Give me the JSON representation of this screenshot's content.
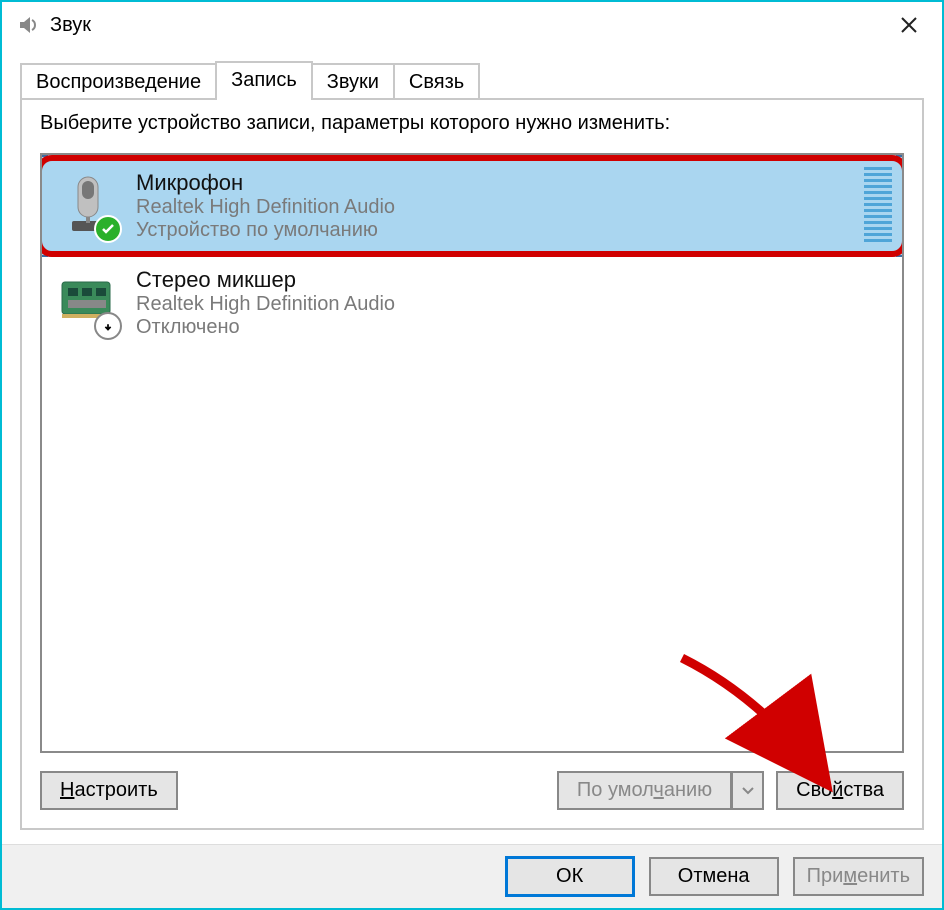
{
  "window": {
    "title": "Звук"
  },
  "tabs": {
    "items": [
      {
        "label": "Воспроизведение"
      },
      {
        "label": "Запись"
      },
      {
        "label": "Звуки"
      },
      {
        "label": "Связь"
      }
    ],
    "activeIndex": 1
  },
  "instruction": "Выберите устройство записи, параметры которого нужно изменить:",
  "devices": [
    {
      "name": "Микрофон",
      "driver": "Realtek High Definition Audio",
      "status": "Устройство по умолчанию",
      "selected": true,
      "badge": "default"
    },
    {
      "name": "Стерео микшер",
      "driver": "Realtek High Definition Audio",
      "status": "Отключено",
      "selected": false,
      "badge": "disabled"
    }
  ],
  "panelButtons": {
    "configure": "Настроить",
    "default": "По умолчанию",
    "properties": "Свойства"
  },
  "dialogButtons": {
    "ok": "ОК",
    "cancel": "Отмена",
    "apply": "Применить"
  }
}
